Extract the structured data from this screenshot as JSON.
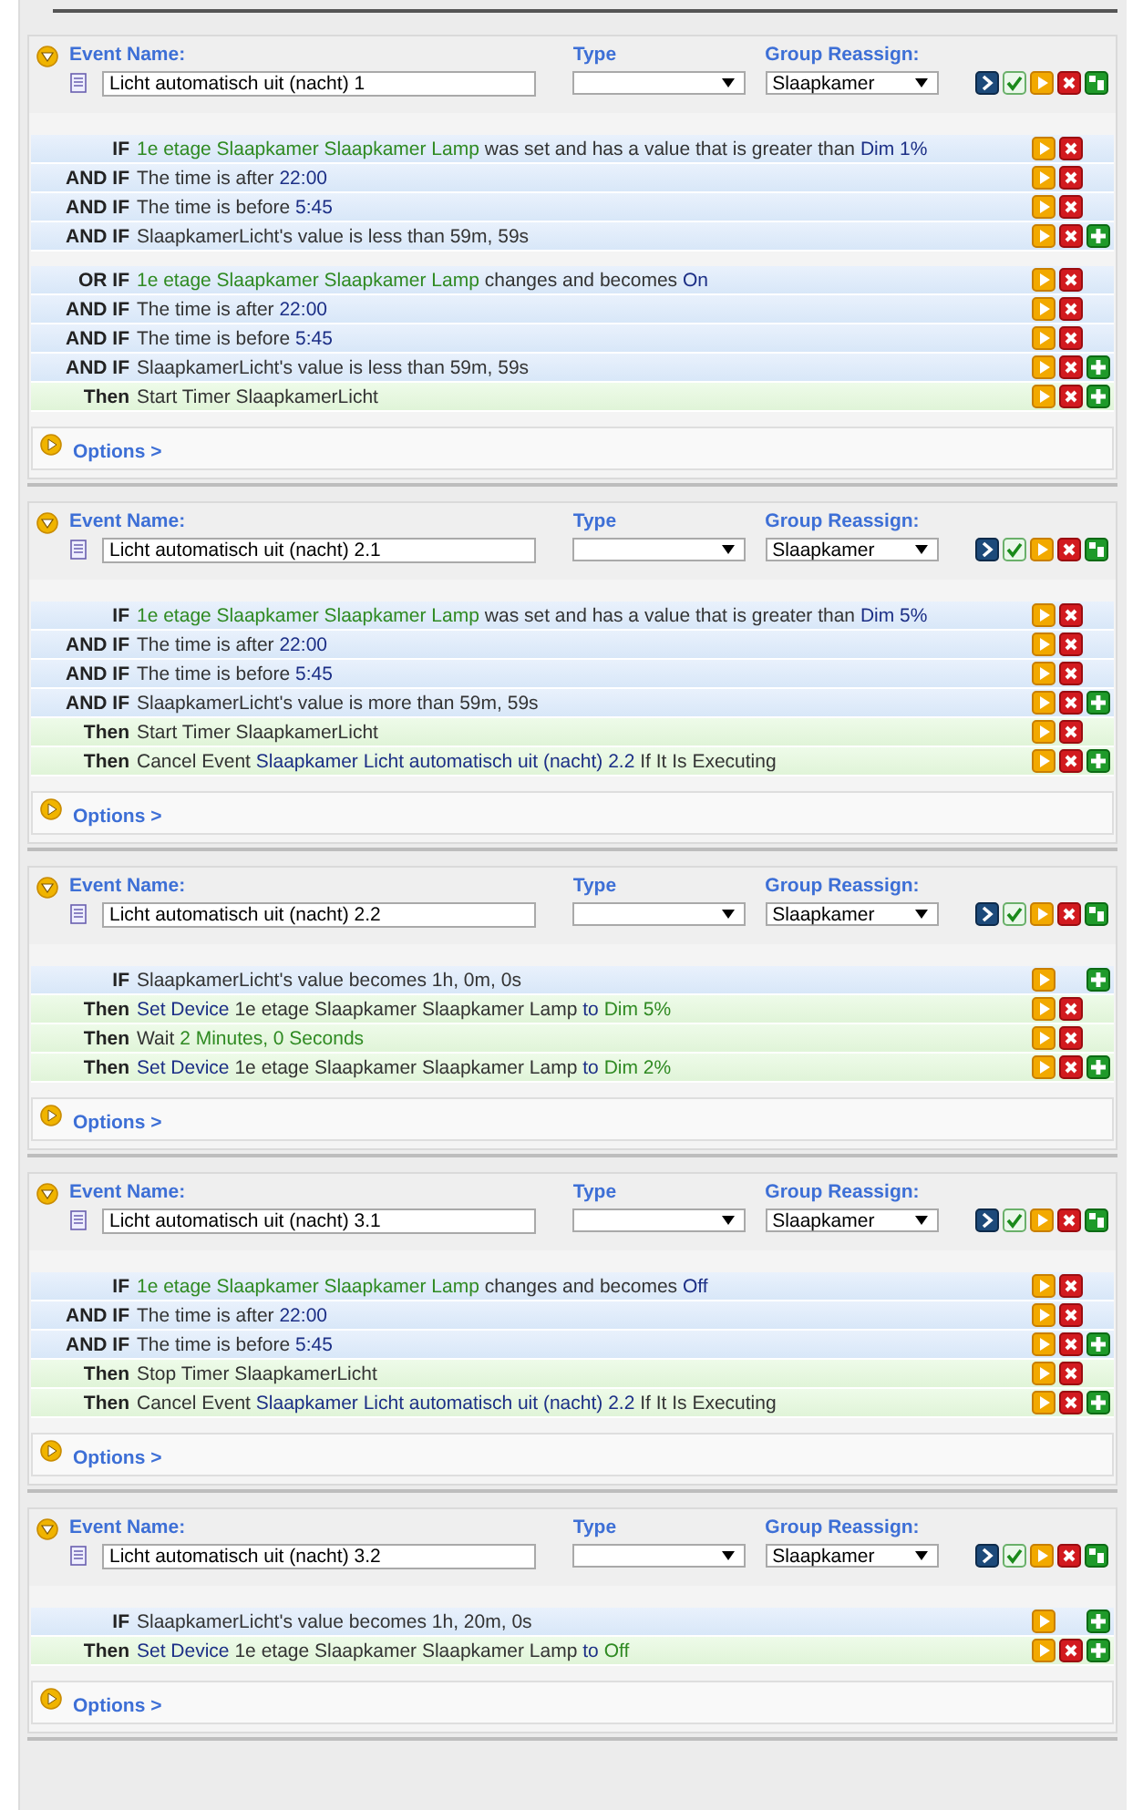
{
  "events": [
    {
      "expanded": true,
      "name_label": "Event Name:",
      "name": "Licht automatisch uit (nacht) 1",
      "type_label": "Type",
      "group_label": "Group Reassign:",
      "group": "Slaapkamer",
      "options_label": "Options >",
      "blocks": [
        [
          {
            "kind": "condition",
            "label": "IF",
            "deletable": true,
            "addable": false,
            "segments": [
              {
                "text": "1e etage Slaapkamer Slaapkamer Lamp",
                "color": "#2f8a22"
              },
              {
                "text": "was set and has a value that is greater than"
              },
              {
                "text": "Dim 1%",
                "color": "#1c2f86"
              }
            ]
          },
          {
            "kind": "condition",
            "label": "AND IF",
            "deletable": true,
            "addable": false,
            "segments": [
              {
                "text": "The time is after"
              },
              {
                "text": "22:00",
                "color": "#1c2f86"
              }
            ]
          },
          {
            "kind": "condition",
            "label": "AND IF",
            "deletable": true,
            "addable": false,
            "segments": [
              {
                "text": "The time is before"
              },
              {
                "text": "5:45",
                "color": "#1c2f86"
              }
            ]
          },
          {
            "kind": "condition",
            "label": "AND IF",
            "deletable": true,
            "addable": true,
            "segments": [
              {
                "text": "SlaapkamerLicht's value is less than 59m, 59s"
              }
            ]
          }
        ],
        [
          {
            "kind": "condition",
            "label": "OR IF",
            "deletable": true,
            "addable": false,
            "segments": [
              {
                "text": "1e etage Slaapkamer Slaapkamer Lamp",
                "color": "#2f8a22"
              },
              {
                "text": "changes and becomes"
              },
              {
                "text": "On",
                "color": "#1c2f86"
              }
            ]
          },
          {
            "kind": "condition",
            "label": "AND IF",
            "deletable": true,
            "addable": false,
            "segments": [
              {
                "text": "The time is after"
              },
              {
                "text": "22:00",
                "color": "#1c2f86"
              }
            ]
          },
          {
            "kind": "condition",
            "label": "AND IF",
            "deletable": true,
            "addable": false,
            "segments": [
              {
                "text": "The time is before"
              },
              {
                "text": "5:45",
                "color": "#1c2f86"
              }
            ]
          },
          {
            "kind": "condition",
            "label": "AND IF",
            "deletable": true,
            "addable": true,
            "segments": [
              {
                "text": "SlaapkamerLicht's value is less than 59m, 59s"
              }
            ]
          },
          {
            "kind": "action",
            "label": "Then",
            "deletable": true,
            "addable": true,
            "segments": [
              {
                "text": "Start Timer SlaapkamerLicht"
              }
            ]
          }
        ]
      ]
    },
    {
      "expanded": true,
      "name_label": "Event Name:",
      "name": "Licht automatisch uit (nacht) 2.1",
      "type_label": "Type",
      "group_label": "Group Reassign:",
      "group": "Slaapkamer",
      "options_label": "Options >",
      "blocks": [
        [
          {
            "kind": "condition",
            "label": "IF",
            "deletable": true,
            "addable": false,
            "segments": [
              {
                "text": "1e etage Slaapkamer Slaapkamer Lamp",
                "color": "#2f8a22"
              },
              {
                "text": "was set and has a value that is greater than"
              },
              {
                "text": "Dim 5%",
                "color": "#1c2f86"
              }
            ]
          },
          {
            "kind": "condition",
            "label": "AND IF",
            "deletable": true,
            "addable": false,
            "segments": [
              {
                "text": "The time is after"
              },
              {
                "text": "22:00",
                "color": "#1c2f86"
              }
            ]
          },
          {
            "kind": "condition",
            "label": "AND IF",
            "deletable": true,
            "addable": false,
            "segments": [
              {
                "text": "The time is before"
              },
              {
                "text": "5:45",
                "color": "#1c2f86"
              }
            ]
          },
          {
            "kind": "condition",
            "label": "AND IF",
            "deletable": true,
            "addable": true,
            "segments": [
              {
                "text": "SlaapkamerLicht's value is more than 59m, 59s"
              }
            ]
          },
          {
            "kind": "action",
            "label": "Then",
            "deletable": true,
            "addable": false,
            "segments": [
              {
                "text": "Start Timer SlaapkamerLicht"
              }
            ]
          },
          {
            "kind": "action",
            "label": "Then",
            "deletable": true,
            "addable": true,
            "segments": [
              {
                "text": "Cancel Event"
              },
              {
                "text": "Slaapkamer Licht automatisch uit (nacht) 2.2",
                "color": "#1c2f86"
              },
              {
                "text": "If It Is Executing"
              }
            ]
          }
        ]
      ]
    },
    {
      "expanded": true,
      "name_label": "Event Name:",
      "name": "Licht automatisch uit (nacht) 2.2",
      "type_label": "Type",
      "group_label": "Group Reassign:",
      "group": "Slaapkamer",
      "options_label": "Options >",
      "blocks": [
        [
          {
            "kind": "condition",
            "label": "IF",
            "deletable": false,
            "addable": true,
            "segments": [
              {
                "text": "SlaapkamerLicht's value becomes 1h, 0m, 0s"
              }
            ]
          },
          {
            "kind": "action",
            "label": "Then",
            "deletable": true,
            "addable": false,
            "segments": [
              {
                "text": "Set Device",
                "color": "#1c2f86"
              },
              {
                "text": "1e etage Slaapkamer Slaapkamer Lamp"
              },
              {
                "text": "to",
                "color": "#1c2f86"
              },
              {
                "text": "Dim 5%",
                "color": "#2f8a22"
              }
            ]
          },
          {
            "kind": "action",
            "label": "Then",
            "deletable": true,
            "addable": false,
            "segments": [
              {
                "text": "Wait"
              },
              {
                "text": "2 Minutes, 0 Seconds",
                "color": "#2f8a22"
              }
            ]
          },
          {
            "kind": "action",
            "label": "Then",
            "deletable": true,
            "addable": true,
            "segments": [
              {
                "text": "Set Device",
                "color": "#1c2f86"
              },
              {
                "text": "1e etage Slaapkamer Slaapkamer Lamp"
              },
              {
                "text": "to",
                "color": "#1c2f86"
              },
              {
                "text": "Dim 2%",
                "color": "#2f8a22"
              }
            ]
          }
        ]
      ]
    },
    {
      "expanded": true,
      "name_label": "Event Name:",
      "name": "Licht automatisch uit (nacht) 3.1",
      "type_label": "Type",
      "group_label": "Group Reassign:",
      "group": "Slaapkamer",
      "options_label": "Options >",
      "blocks": [
        [
          {
            "kind": "condition",
            "label": "IF",
            "deletable": true,
            "addable": false,
            "segments": [
              {
                "text": "1e etage Slaapkamer Slaapkamer Lamp",
                "color": "#2f8a22"
              },
              {
                "text": "changes and becomes"
              },
              {
                "text": "Off",
                "color": "#1c2f86"
              }
            ]
          },
          {
            "kind": "condition",
            "label": "AND IF",
            "deletable": true,
            "addable": false,
            "segments": [
              {
                "text": "The time is after"
              },
              {
                "text": "22:00",
                "color": "#1c2f86"
              }
            ]
          },
          {
            "kind": "condition",
            "label": "AND IF",
            "deletable": true,
            "addable": true,
            "segments": [
              {
                "text": "The time is before"
              },
              {
                "text": "5:45",
                "color": "#1c2f86"
              }
            ]
          },
          {
            "kind": "action",
            "label": "Then",
            "deletable": true,
            "addable": false,
            "segments": [
              {
                "text": "Stop Timer SlaapkamerLicht"
              }
            ]
          },
          {
            "kind": "action",
            "label": "Then",
            "deletable": true,
            "addable": true,
            "segments": [
              {
                "text": "Cancel Event"
              },
              {
                "text": "Slaapkamer Licht automatisch uit (nacht) 2.2",
                "color": "#1c2f86"
              },
              {
                "text": "If It Is Executing"
              }
            ]
          }
        ]
      ]
    },
    {
      "expanded": true,
      "name_label": "Event Name:",
      "name": "Licht automatisch uit (nacht) 3.2",
      "type_label": "Type",
      "group_label": "Group Reassign:",
      "group": "Slaapkamer",
      "options_label": "Options >",
      "blocks": [
        [
          {
            "kind": "condition",
            "label": "IF",
            "deletable": false,
            "addable": true,
            "segments": [
              {
                "text": "SlaapkamerLicht's value becomes 1h, 20m, 0s"
              }
            ]
          },
          {
            "kind": "action",
            "label": "Then",
            "deletable": true,
            "addable": true,
            "segments": [
              {
                "text": "Set Device",
                "color": "#1c2f86"
              },
              {
                "text": "1e etage Slaapkamer Slaapkamer Lamp"
              },
              {
                "text": "to",
                "color": "#1c2f86"
              },
              {
                "text": "Off",
                "color": "#2f8a22"
              }
            ]
          }
        ]
      ]
    }
  ]
}
